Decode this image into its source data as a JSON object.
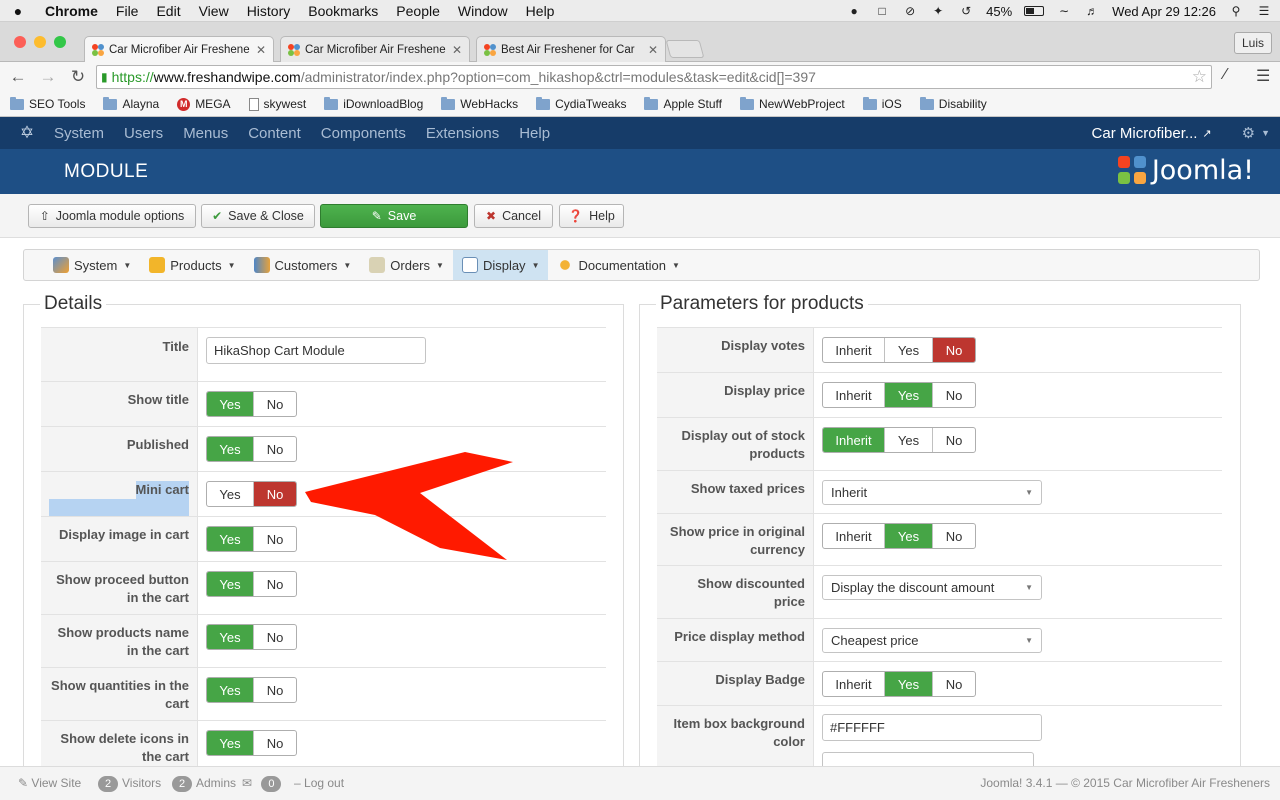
{
  "mac_menu": {
    "items": [
      "Chrome",
      "File",
      "Edit",
      "View",
      "History",
      "Bookmarks",
      "People",
      "Window",
      "Help"
    ],
    "battery": "45%",
    "clock": "Wed Apr 29  12:26"
  },
  "browser": {
    "tabs": [
      {
        "title": "Car Microfiber Air Freshene"
      },
      {
        "title": "Car Microfiber Air Freshene"
      },
      {
        "title": "Best Air Freshener for Car"
      }
    ],
    "profile": "Luis",
    "url": {
      "scheme": "https://",
      "domain": "www.freshandwipe.com",
      "path": "/administrator/index.php?option=com_hikashop&ctrl=modules&task=edit&cid[]=397"
    },
    "bookmarks": [
      "SEO Tools",
      "Alayna",
      "MEGA",
      "skywest",
      "iDownloadBlog",
      "WebHacks",
      "CydiaTweaks",
      "Apple Stuff",
      "NewWebProject",
      "iOS",
      "Disability"
    ]
  },
  "joomla": {
    "nav": [
      "System",
      "Users",
      "Menus",
      "Content",
      "Components",
      "Extensions",
      "Help"
    ],
    "site_link": "Car Microfiber...",
    "page_title": "MODULE",
    "brand": "Joomla!",
    "buttons": {
      "module_options": "Joomla module options",
      "save_close": "Save & Close",
      "save": "Save",
      "cancel": "Cancel",
      "help": "Help"
    },
    "hika_menu": [
      "System",
      "Products",
      "Customers",
      "Orders",
      "Display",
      "Documentation"
    ]
  },
  "details": {
    "legend": "Details",
    "title_label": "Title",
    "title_value": "HikaShop Cart Module",
    "rows": [
      {
        "label": "Show title",
        "value": "Yes"
      },
      {
        "label": "Published",
        "value": "Yes"
      },
      {
        "label": "Mini cart",
        "value": "No"
      },
      {
        "label": "Display image in cart",
        "value": "Yes"
      },
      {
        "label": "Show proceed button in the cart",
        "value": "Yes"
      },
      {
        "label": "Show products name in the cart",
        "value": "Yes"
      },
      {
        "label": "Show quantities in the cart",
        "value": "Yes"
      },
      {
        "label": "Show delete icons in the cart",
        "value": "Yes"
      }
    ],
    "yes": "Yes",
    "no": "No"
  },
  "params": {
    "legend": "Parameters for products",
    "inherit": "Inherit",
    "yes": "Yes",
    "no": "No",
    "rows": [
      {
        "label": "Display votes",
        "type": "toggle3",
        "value": "No"
      },
      {
        "label": "Display price",
        "type": "toggle3",
        "value": "Yes"
      },
      {
        "label": "Display out of stock products",
        "type": "toggle3",
        "value": "Inherit"
      },
      {
        "label": "Show taxed prices",
        "type": "select",
        "value": "Inherit"
      },
      {
        "label": "Show price in original currency",
        "type": "toggle3",
        "value": "Yes"
      },
      {
        "label": "Show discounted price",
        "type": "select",
        "value": "Display the discount amount"
      },
      {
        "label": "Price display method",
        "type": "select",
        "value": "Cheapest price"
      },
      {
        "label": "Display Badge",
        "type": "toggle3",
        "value": "Yes"
      },
      {
        "label": "Item box background color",
        "type": "input",
        "value": "#FFFFFF"
      }
    ]
  },
  "status": {
    "view_site": "View Site",
    "visitors_count": "2",
    "visitors": "Visitors",
    "admins_count": "2",
    "admins": "Admins",
    "messages_count": "0",
    "logout": "Log out",
    "footer": "Joomla! 3.4.1  —  © 2015 Car Microfiber Air Fresheners"
  },
  "colors": {
    "joomla_nav": "#163c69",
    "joomla_header": "#1e4f85",
    "toggle_green": "#46a546",
    "toggle_red": "#bd362f",
    "annotation_arrow": "#ff1a00"
  }
}
